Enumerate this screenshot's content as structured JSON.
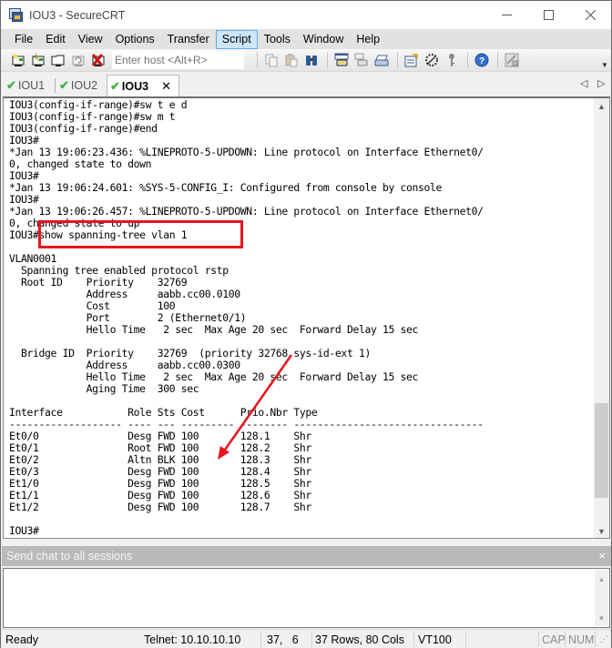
{
  "window": {
    "title": "IOU3 - SecureCRT",
    "controls": {
      "minimize": "minimize-icon",
      "maximize": "maximize-icon",
      "close": "close-icon"
    }
  },
  "menu": {
    "items": [
      "File",
      "Edit",
      "View",
      "Options",
      "Transfer",
      "Script",
      "Tools",
      "Window",
      "Help"
    ],
    "active": "Script"
  },
  "toolbar": {
    "left_icons": [
      "connect-icon",
      "quick-connect-icon",
      "connect-in-tab-icon",
      "reconnect-icon",
      "disconnect-icon"
    ],
    "host_placeholder": "Enter host <Alt+R>",
    "right_icons": [
      "copy-icon",
      "paste-icon",
      "find-icon",
      "print-screen-icon",
      "print-selection-icon",
      "print-icon",
      "session-options-icon",
      "global-options-icon",
      "key-icon",
      "help-icon",
      "lock-icon"
    ]
  },
  "tabs": {
    "items": [
      {
        "label": "IOU1",
        "status": "connected",
        "active": false
      },
      {
        "label": "IOU2",
        "status": "connected",
        "active": false
      },
      {
        "label": "IOU3",
        "status": "connected",
        "active": true
      }
    ],
    "close_glyph": "✕",
    "nav_prev": "◁",
    "nav_next": "▷"
  },
  "terminal": {
    "lines": [
      "IOU3(config-if-range)#sw t e d",
      "IOU3(config-if-range)#sw m t",
      "IOU3(config-if-range)#end",
      "IOU3#",
      "*Jan 13 19:06:23.436: %LINEPROTO-5-UPDOWN: Line protocol on Interface Ethernet0/",
      "0, changed state to down",
      "IOU3#",
      "*Jan 13 19:06:24.601: %SYS-5-CONFIG_I: Configured from console by console",
      "IOU3#",
      "*Jan 13 19:06:26.457: %LINEPROTO-5-UPDOWN: Line protocol on Interface Ethernet0/",
      "0, changed state to up",
      "IOU3#show spanning-tree vlan 1",
      "",
      "VLAN0001",
      "  Spanning tree enabled protocol rstp",
      "  Root ID    Priority    32769",
      "             Address     aabb.cc00.0100",
      "             Cost        100",
      "             Port        2 (Ethernet0/1)",
      "             Hello Time   2 sec  Max Age 20 sec  Forward Delay 15 sec",
      "",
      "  Bridge ID  Priority    32769  (priority 32768 sys-id-ext 1)",
      "             Address     aabb.cc00.0300",
      "             Hello Time   2 sec  Max Age 20 sec  Forward Delay 15 sec",
      "             Aging Time  300 sec",
      "",
      "Interface           Role Sts Cost      Prio.Nbr Type",
      "------------------- ---- --- --------- -------- --------------------------------",
      "Et0/0               Desg FWD 100       128.1    Shr",
      "Et0/1               Root FWD 100       128.2    Shr",
      "Et0/2               Altn BLK 100       128.3    Shr",
      "Et0/3               Desg FWD 100       128.4    Shr",
      "Et1/0               Desg FWD 100       128.5    Shr",
      "Et1/1               Desg FWD 100       128.6    Shr",
      "Et1/2               Desg FWD 100       128.7    Shr",
      "",
      "IOU3#"
    ],
    "scroll_position": 0.92
  },
  "annotations": {
    "highlight_box_target": "show spanning-tree vlan 1",
    "arrow_target": "Et0/2 Altn BLK",
    "color": "#e8141c"
  },
  "chat": {
    "header": "Send chat to all sessions",
    "close_glyph": "×",
    "value": ""
  },
  "statusbar": {
    "status": "Ready",
    "connection": "Telnet: 10.10.10.10",
    "cursor": "37,   6",
    "size": "37 Rows, 80 Cols",
    "emulation": "VT100",
    "cap": "CAP",
    "num": "NUM"
  }
}
